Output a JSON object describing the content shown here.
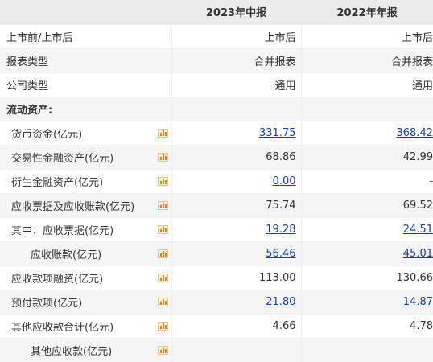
{
  "header": {
    "col_current": "2023年中报",
    "col_previous": "2022年年报"
  },
  "rows": [
    {
      "label": "上市前/上市后",
      "current": "上市后",
      "previous": "上市后"
    },
    {
      "label": "报表类型",
      "current": "合并报表",
      "previous": "合并报表"
    },
    {
      "label": "公司类型",
      "current": "通用",
      "previous": "通用"
    },
    {
      "label": "流动资产:"
    },
    {
      "label": "货币资金(亿元)",
      "current": "331.75",
      "previous": "368.42"
    },
    {
      "label": "交易性金融资产(亿元)",
      "current": "68.86",
      "previous": "42.99"
    },
    {
      "label": "衍生金融资产(亿元)",
      "current": "0.00",
      "previous": "-"
    },
    {
      "label": "应收票据及应收账款(亿元)",
      "current": "75.74",
      "previous": "69.52"
    },
    {
      "label": "其中：应收票据(亿元)",
      "current": "19.28",
      "previous": "24.51"
    },
    {
      "label": "应收账款(亿元)",
      "current": "56.46",
      "previous": "45.01"
    },
    {
      "label": "应收款项融资(亿元)",
      "current": "113.00",
      "previous": "130.66"
    },
    {
      "label": "预付款项(亿元)",
      "current": "21.80",
      "previous": "14.87"
    },
    {
      "label": "其他应收款合计(亿元)",
      "current": "4.66",
      "previous": "4.78"
    },
    {
      "label": "其他应收款(亿元)"
    }
  ]
}
